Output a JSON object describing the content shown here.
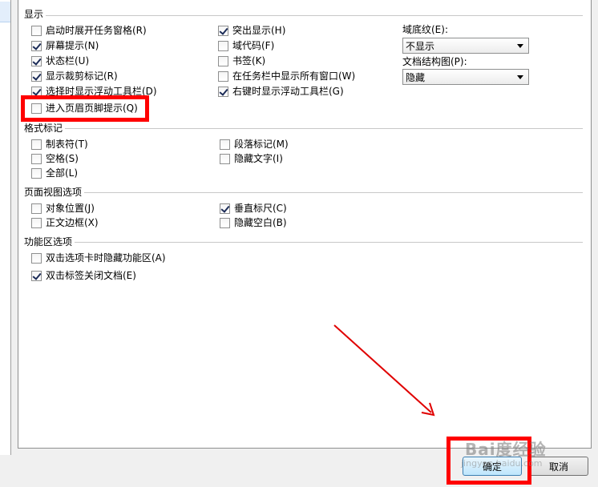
{
  "sections": {
    "display": "显示",
    "format_marks": "格式标记",
    "page_view": "页面视图选项",
    "ribbon": "功能区选项"
  },
  "display_options": [
    {
      "label": "启动时展开任务窗格(R)",
      "checked": false
    },
    {
      "label": "屏幕提示(N)",
      "checked": true
    },
    {
      "label": "状态栏(U)",
      "checked": true
    },
    {
      "label": "显示裁剪标记(R)",
      "checked": true
    },
    {
      "label": "选择时显示浮动工具栏(D)",
      "checked": true
    },
    {
      "label": "进入页眉页脚提示(Q)",
      "checked": false
    },
    {
      "label": "突出显示(H)",
      "checked": true
    },
    {
      "label": "域代码(F)",
      "checked": false
    },
    {
      "label": "书签(K)",
      "checked": false
    },
    {
      "label": "在任务栏中显示所有窗口(W)",
      "checked": false
    },
    {
      "label": "右键时显示浮动工具栏(G)",
      "checked": true
    }
  ],
  "field_shading": {
    "label": "域底纹(E):",
    "value": "不显示"
  },
  "doc_map": {
    "label": "文档结构图(P):",
    "value": "隐藏"
  },
  "format_options": [
    {
      "label": "制表符(T)",
      "checked": false
    },
    {
      "label": "空格(S)",
      "checked": false
    },
    {
      "label": "全部(L)",
      "checked": false
    },
    {
      "label": "段落标记(M)",
      "checked": false
    },
    {
      "label": "隐藏文字(I)",
      "checked": false
    }
  ],
  "page_view_options": [
    {
      "label": "对象位置(J)",
      "checked": false
    },
    {
      "label": "正文边框(X)",
      "checked": false
    },
    {
      "label": "垂直标尺(C)",
      "checked": true
    },
    {
      "label": "隐藏空白(B)",
      "checked": false
    }
  ],
  "ribbon_options": [
    {
      "label": "双击选项卡时隐藏功能区(A)",
      "checked": false
    },
    {
      "label": "双击标签关闭文档(E)",
      "checked": true
    }
  ],
  "buttons": {
    "ok": "确定",
    "cancel": "取消"
  },
  "watermark": {
    "logo": "Bai度经验",
    "url": "jingyan.baidu.com"
  },
  "colors": {
    "annotation": "#ff0000",
    "check": "#1c2c58"
  }
}
